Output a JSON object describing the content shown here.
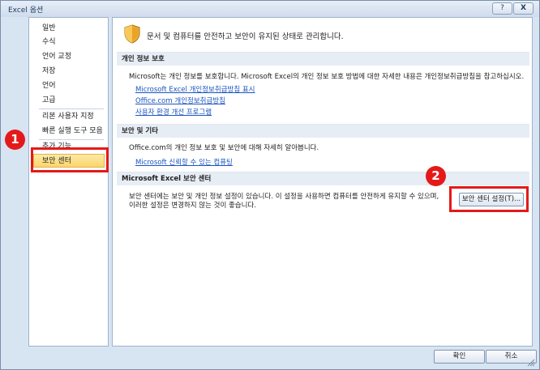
{
  "window": {
    "title": "Excel 옵션",
    "help_glyph": "?",
    "close_glyph": "X"
  },
  "sidebar": {
    "items": [
      {
        "label": "일반"
      },
      {
        "label": "수식"
      },
      {
        "label": "언어 교정"
      },
      {
        "label": "저장"
      },
      {
        "label": "언어"
      },
      {
        "label": "고급"
      },
      {
        "label": "리본 사용자 지정"
      },
      {
        "label": "빠른 실행 도구 모음"
      },
      {
        "label": "추가 기능"
      },
      {
        "label": "보안 센터"
      }
    ],
    "selected": "보안 센터"
  },
  "main": {
    "header": "문서 및 컴퓨터를 안전하고 보안이 유지된 상태로 관리합니다.",
    "privacy": {
      "title": "개인 정보 보호",
      "text": "Microsoft는 개인 정보를 보호합니다. Microsoft Excel의 개인 정보 보호 방법에 대한 자세한 내용은 개인정보취급방침을 참고하십시오.",
      "links": [
        "Microsoft Excel 개인정보취급방침 표시",
        "Office.com 개인정보취급방침",
        "사용자 환경 개선 프로그램"
      ]
    },
    "security": {
      "title": "보안 및 기타",
      "text": "Office.com의 개인 정보 보호 및 보안에 대해 자세히 알아봅니다.",
      "link": "Microsoft 신뢰할 수 있는 컴퓨팅"
    },
    "trust_center": {
      "title": "Microsoft Excel 보안 센터",
      "text_line1": "보안 센터에는 보안 및 개인 정보 설정이 있습니다. 이 설정을 사용하면 컴퓨터를 안전하게 유지할 수 있으며,",
      "text_line2": "이러한 설정은 변경하지 않는 것이 좋습니다.",
      "button": "보안 센터 설정(T)..."
    }
  },
  "footer": {
    "ok": "확인",
    "cancel": "취소"
  },
  "annotations": {
    "badge1": "1",
    "badge2": "2",
    "color": "#e41a1a"
  }
}
